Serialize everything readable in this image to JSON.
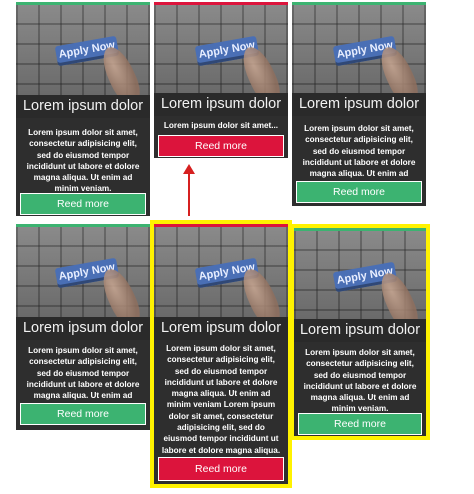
{
  "cards": [
    {
      "image_key_label": "Apply Now",
      "title": "Lorem ipsum dolor",
      "body": "Lorem ipsum dolor sit amet, consectetur adipisicing elit, sed do eiusmod tempor incididunt ut labore et dolore magna aliqua. Ut enim ad minim veniam.",
      "button_label": "Reed more",
      "button_color": "#3cb371"
    },
    {
      "image_key_label": "Apply Now",
      "title": "Lorem ipsum dolor",
      "body": "Lorem ipsum dolor sit amet...",
      "button_label": "Reed more",
      "button_color": "#dc143c"
    },
    {
      "image_key_label": "Apply Now",
      "title": "Lorem ipsum dolor",
      "body": "Lorem ipsum dolor sit amet, consectetur adipisicing elit, sed do eiusmod tempor incididunt ut labore et dolore magna aliqua. Ut enim ad minim veniam.",
      "button_label": "Reed more",
      "button_color": "#3cb371"
    },
    {
      "image_key_label": "Apply Now",
      "title": "Lorem ipsum dolor",
      "body": "Lorem ipsum dolor sit amet, consectetur adipisicing elit, sed do eiusmod tempor incididunt ut labore et dolore magna aliqua. Ut enim ad minim veniam",
      "button_label": "Reed more",
      "button_color": "#3cb371"
    },
    {
      "image_key_label": "Apply Now",
      "title": "Lorem ipsum dolor",
      "body": "Lorem ipsum dolor sit amet, consectetur adipisicing elit, sed do eiusmod tempor incididunt ut labore et dolore magna aliqua. Ut enim ad minim veniam Lorem ipsum dolor sit amet, consectetur adipisicing elit, sed do eiusmod tempor incididunt ut labore et dolore magna aliqua. Ut enim ad minim veniam",
      "button_label": "Reed more",
      "button_color": "#dc143c"
    },
    {
      "image_key_label": "Apply Now",
      "title": "Lorem ipsum dolor",
      "body": "Lorem ipsum dolor sit amet, consectetur adipisicing elit, sed do eiusmod tempor incididunt ut labore et dolore magna aliqua. Ut enim ad minim veniam.",
      "button_label": "Reed more",
      "button_color": "#3cb371"
    }
  ],
  "colors": {
    "accent_green": "#3cb371",
    "accent_red": "#dc143c",
    "highlight_yellow": "#fff200",
    "arrow_red": "#d62020"
  }
}
